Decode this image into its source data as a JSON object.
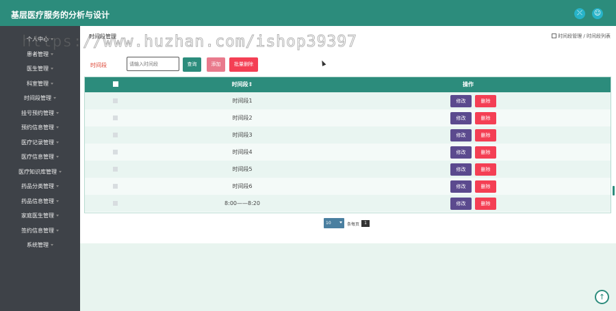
{
  "app": {
    "title": "基层医疗服务的分析与设计"
  },
  "topbar": {
    "icons": [
      "switch-icon",
      "user-icon"
    ]
  },
  "sidebar": {
    "items": [
      {
        "label": "个人中心"
      },
      {
        "label": "患者管理"
      },
      {
        "label": "医生管理"
      },
      {
        "label": "科室管理"
      },
      {
        "label": "时间段管理"
      },
      {
        "label": "挂号预约管理"
      },
      {
        "label": "预约信息管理"
      },
      {
        "label": "医疗记录管理"
      },
      {
        "label": "医疗信息管理"
      },
      {
        "label": "医疗知识库管理"
      },
      {
        "label": "药品分类管理"
      },
      {
        "label": "药品信息管理"
      },
      {
        "label": "家庭医生管理"
      },
      {
        "label": "签约信息管理"
      },
      {
        "label": "系统管理"
      }
    ]
  },
  "page": {
    "title": "时间段管理"
  },
  "breadcrumb": {
    "text": "时间段管理 / 时间段列表"
  },
  "filter": {
    "label": "时间段",
    "placeholder": "请输入时间段",
    "search_label": "查询",
    "add_label": "添加",
    "batch_delete_label": "批量删除"
  },
  "table": {
    "headers": {
      "time": "时间段⇕",
      "ops": "操作"
    },
    "edit_label": "修改",
    "delete_label": "删除",
    "rows": [
      {
        "time": "时间段1"
      },
      {
        "time": "时间段2"
      },
      {
        "time": "时间段3"
      },
      {
        "time": "时间段4"
      },
      {
        "time": "时间段5"
      },
      {
        "time": "时间段6"
      },
      {
        "time": "8:00——8:20"
      }
    ]
  },
  "pager": {
    "page_size": "10",
    "per_page_text": "条每页",
    "current_page": "1"
  },
  "watermark": {
    "text": "https://www.huzhan.com/ishop39397"
  },
  "colors": {
    "primary": "#2c8c7c",
    "danger": "#f43f54",
    "edit": "#5b4a8e",
    "sidebar": "#3e4248"
  }
}
